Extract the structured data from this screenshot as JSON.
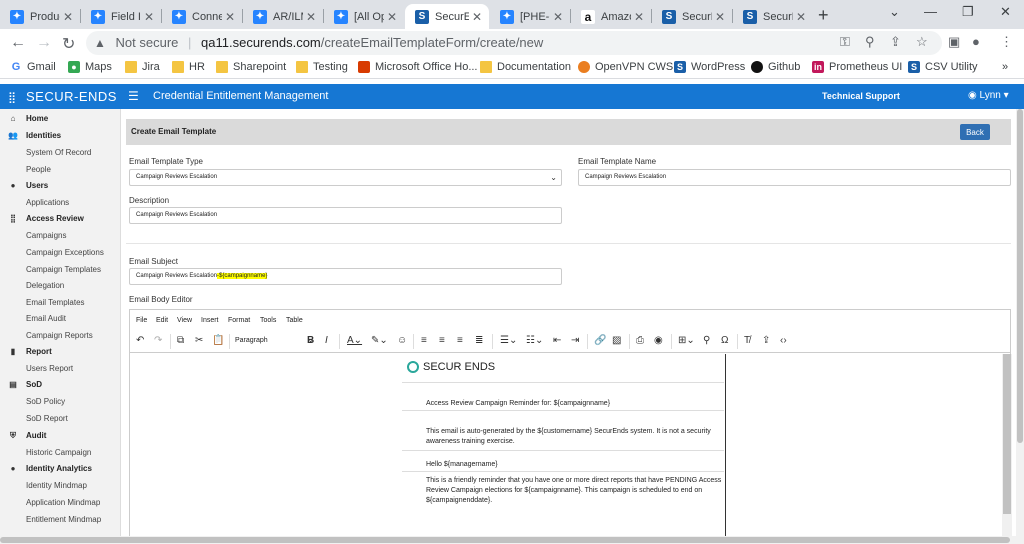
{
  "browser": {
    "tabs": [
      {
        "label": "Produc",
        "icon": "jira-icon"
      },
      {
        "label": "Field Is",
        "icon": "jira-icon"
      },
      {
        "label": "Conne",
        "icon": "jira-icon"
      },
      {
        "label": "AR/ILM",
        "icon": "jira-icon"
      },
      {
        "label": "[All Op",
        "icon": "jira-icon"
      },
      {
        "label": "SecurE",
        "icon": "securends-icon"
      },
      {
        "label": "[PHE-6",
        "icon": "jira-icon"
      },
      {
        "label": "Amazo",
        "icon": "amazon-icon"
      },
      {
        "label": "SecurE",
        "icon": "securends-icon"
      },
      {
        "label": "SecurE",
        "icon": "securends-icon"
      }
    ],
    "address": {
      "security": "Not secure",
      "host": "qa11.securends.com",
      "path": "/createEmailTemplateForm/create/new"
    },
    "bookmarks": [
      "Gmail",
      "Maps",
      "Jira",
      "HR",
      "Sharepoint",
      "Testing",
      "Microsoft Office Ho...",
      "Documentation",
      "OpenVPN CWS",
      "WordPress",
      "Github",
      "Prometheus UI",
      "CSV Utility"
    ],
    "bookmarks_more": "»"
  },
  "app": {
    "logo": "SECUR-ENDS",
    "title": "Credential Entitlement Management",
    "support": "Technical Support",
    "user": "Lynn"
  },
  "sidebar": {
    "items": [
      {
        "label": "Home",
        "type": "section",
        "icon": "home-icon"
      },
      {
        "label": "Identities",
        "type": "section",
        "icon": "users-icon"
      },
      {
        "label": "System Of Record",
        "type": "sub"
      },
      {
        "label": "People",
        "type": "sub"
      },
      {
        "label": "Users",
        "type": "section",
        "icon": "user-icon"
      },
      {
        "label": "Applications",
        "type": "sub"
      },
      {
        "label": "Access Review",
        "type": "section",
        "icon": "grid-icon"
      },
      {
        "label": "Campaigns",
        "type": "sub"
      },
      {
        "label": "Campaign Exceptions",
        "type": "sub"
      },
      {
        "label": "Campaign Templates",
        "type": "sub"
      },
      {
        "label": "Delegation",
        "type": "sub"
      },
      {
        "label": "Email Templates",
        "type": "sub"
      },
      {
        "label": "Email Audit",
        "type": "sub"
      },
      {
        "label": "Campaign Reports",
        "type": "sub"
      },
      {
        "label": "Report",
        "type": "section",
        "icon": "report-icon"
      },
      {
        "label": "Users Report",
        "type": "sub"
      },
      {
        "label": "SoD",
        "type": "section",
        "icon": "list-icon"
      },
      {
        "label": "SoD Policy",
        "type": "sub"
      },
      {
        "label": "SoD Report",
        "type": "sub"
      },
      {
        "label": "Audit",
        "type": "section",
        "icon": "shield-icon"
      },
      {
        "label": "Historic Campaign",
        "type": "sub"
      },
      {
        "label": "Identity Analytics",
        "type": "section",
        "icon": "analytics-icon"
      },
      {
        "label": "Identity Mindmap",
        "type": "sub"
      },
      {
        "label": "Application Mindmap",
        "type": "sub"
      },
      {
        "label": "Entitlement Mindmap",
        "type": "sub"
      }
    ]
  },
  "form": {
    "header": "Create Email Template",
    "back": "Back",
    "type_label": "Email Template Type",
    "type_value": "Campaign Reviews Escalation",
    "name_label": "Email Template Name",
    "name_value": "Campaign Reviews Escalation",
    "desc_label": "Description",
    "desc_value": "Campaign Reviews Escalation",
    "subject_label": "Email Subject",
    "subject_value": "Campaign Reviews Escalation",
    "subject_var": "-${campaignname}",
    "body_label": "Email Body Editor"
  },
  "editor": {
    "menu": [
      "File",
      "Edit",
      "View",
      "Insert",
      "Format",
      "Tools",
      "Table"
    ],
    "block_format": "Paragraph",
    "content": {
      "logo": "SECUR ENDS",
      "line1": "Access Review Campaign Reminder for: ${campaignname}",
      "line2": "This email is auto-generated by the ${customername} SecurEnds system. It is not a security awareness training exercise.",
      "line3": "Hello ${managername}",
      "line4": "This is a friendly reminder that you have one or more direct reports that have PENDING Access Review Campaign elections for ${campaignname}. This campaign is scheduled to end on ${campaignenddate}."
    }
  }
}
